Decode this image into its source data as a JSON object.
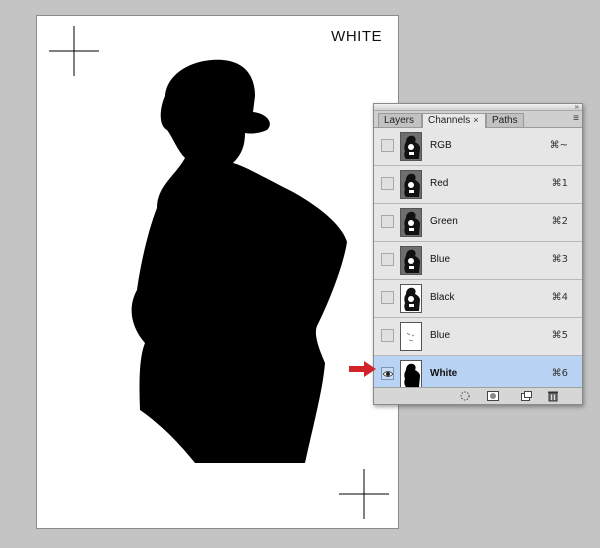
{
  "canvas": {
    "label": "WHITE"
  },
  "panel": {
    "tabs": [
      {
        "label": "Layers",
        "active": false
      },
      {
        "label": "Channels",
        "active": true
      },
      {
        "label": "Paths",
        "active": false
      }
    ],
    "close_glyph": "×",
    "channels": [
      {
        "name": "RGB",
        "shortcut": "⌘~",
        "visible": false,
        "selected": false,
        "thumb": "gray"
      },
      {
        "name": "Red",
        "shortcut": "⌘1",
        "visible": false,
        "selected": false,
        "thumb": "gray"
      },
      {
        "name": "Green",
        "shortcut": "⌘2",
        "visible": false,
        "selected": false,
        "thumb": "gray"
      },
      {
        "name": "Blue",
        "shortcut": "⌘3",
        "visible": false,
        "selected": false,
        "thumb": "gray"
      },
      {
        "name": "Black",
        "shortcut": "⌘4",
        "visible": false,
        "selected": false,
        "thumb": "white-detail"
      },
      {
        "name": "Blue",
        "shortcut": "⌘5",
        "visible": false,
        "selected": false,
        "thumb": "white-faint"
      },
      {
        "name": "White",
        "shortcut": "⌘6",
        "visible": true,
        "selected": true,
        "thumb": "white-silhouette"
      }
    ],
    "footer_buttons": [
      "load-selection-icon",
      "save-selection-icon",
      "new-channel-icon",
      "trash-icon"
    ]
  },
  "colors": {
    "selected_row": "#b9d3f4",
    "arrow": "#d2232a"
  }
}
